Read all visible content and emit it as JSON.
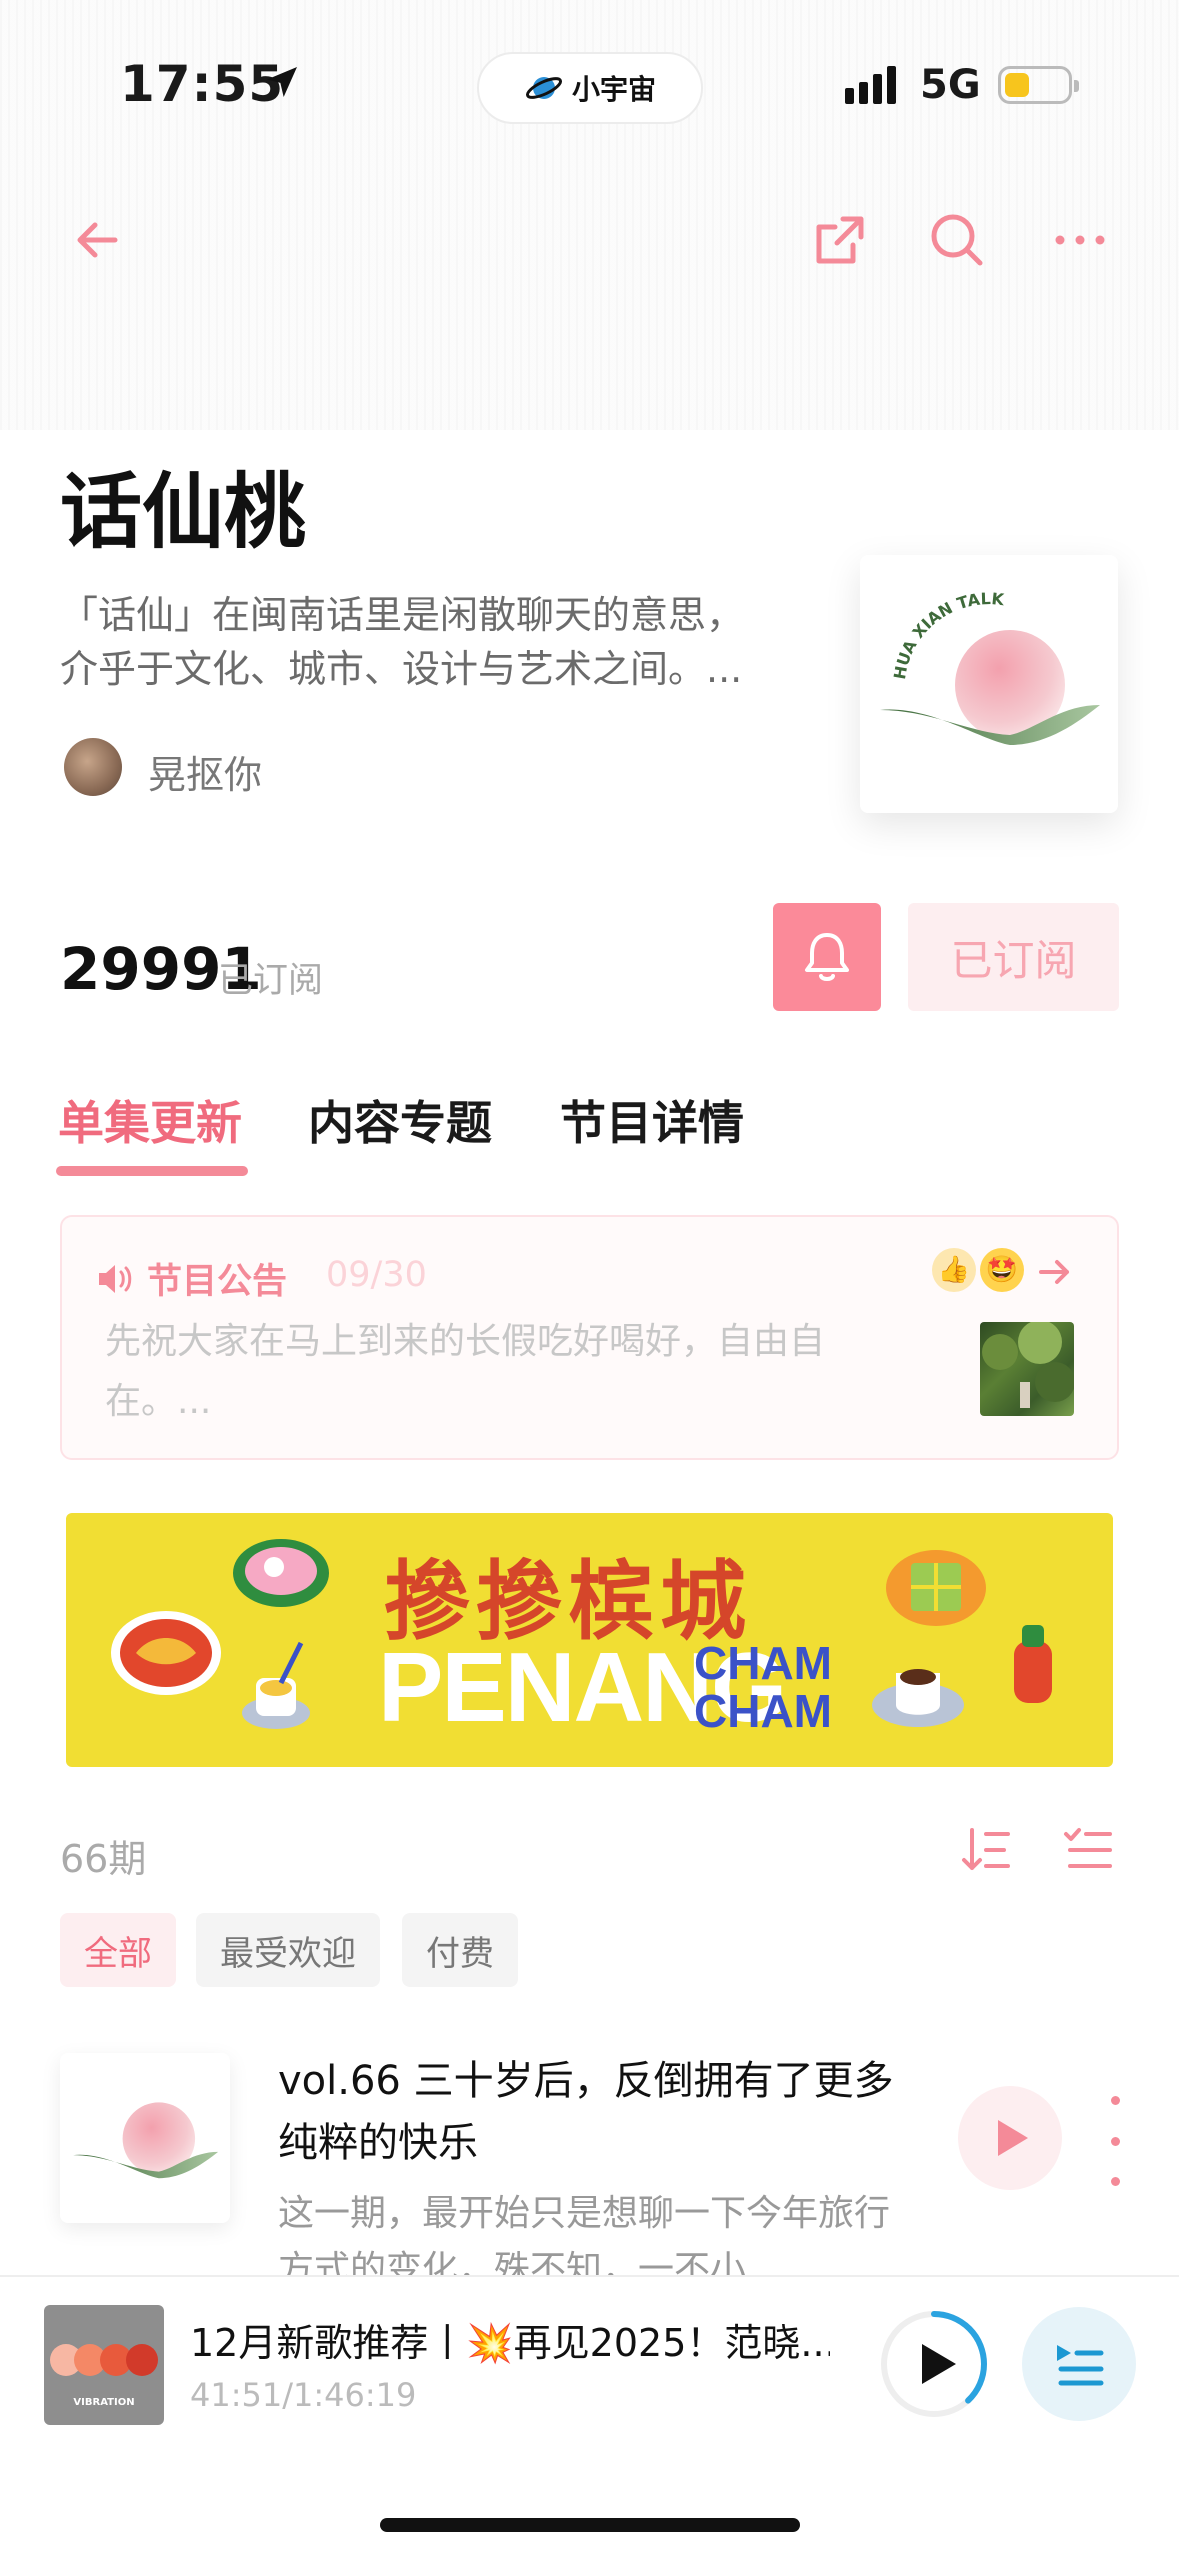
{
  "status_bar": {
    "time": "17:55",
    "pill_label": "小宇宙",
    "network": "5G"
  },
  "nav": {
    "icons": [
      "arrow-left-icon",
      "share-icon",
      "search-icon",
      "more-icon"
    ]
  },
  "podcast": {
    "title": "话仙桃",
    "description": "「话仙」在闽南话里是闲散聊天的意思，介乎于文化、城市、设计与艺术之间。...",
    "author": "晃抠你",
    "cover_text": "HUA XIAN TALK",
    "subscriber_count": "29991",
    "subscriber_label": "已订阅",
    "subscribed_button": "已订阅"
  },
  "tabs": [
    {
      "label": "单集更新",
      "active": true
    },
    {
      "label": "内容专题",
      "active": false
    },
    {
      "label": "节目详情",
      "active": false
    }
  ],
  "notice": {
    "title": "节目公告",
    "date": "09/30",
    "body": "先祝大家在马上到来的长假吃好喝好，自由自在。..."
  },
  "banner": {
    "cn_title": "摻摻槟城",
    "en_title": "PENANG",
    "en_sub_1": "CHAM",
    "en_sub_2": "CHAM"
  },
  "episodes": {
    "count": "66期",
    "filters": [
      {
        "label": "全部",
        "active": true
      },
      {
        "label": "最受欢迎",
        "active": false
      },
      {
        "label": "付费",
        "active": false
      }
    ],
    "items": [
      {
        "title": "vol.66 三十岁后，反倒拥有了更多纯粹的快乐",
        "desc": "这一期，最开始只是想聊一下今年旅行方式的变化，殊不知，一不小"
      }
    ]
  },
  "player": {
    "cover_text": "VIBRATION",
    "title": "12月新歌推荐丨💥再见2025！范晓...",
    "time": "41:51/1:46:19",
    "progress": 0.38
  },
  "colors": {
    "accent": "#f06b7e",
    "accent_light": "#fdeef0",
    "banner_bg": "#f1de33",
    "player_ring": "#2ba3e0"
  }
}
